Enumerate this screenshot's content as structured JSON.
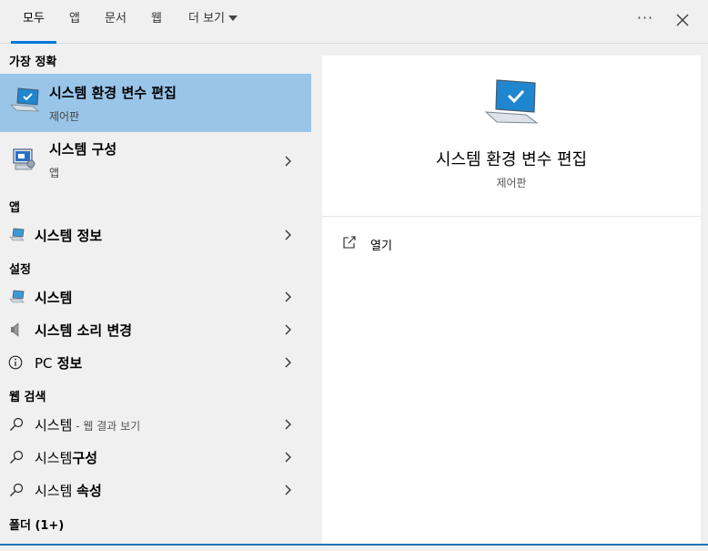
{
  "tabs": [
    {
      "label": "모두",
      "active": true
    },
    {
      "label": "앱",
      "active": false
    },
    {
      "label": "문서",
      "active": false
    },
    {
      "label": "웹",
      "active": false
    },
    {
      "label": "더 보기",
      "active": false
    }
  ],
  "header": {
    "more_options": "···"
  },
  "best_match": {
    "section_label": "가장 정확",
    "title": "시스템 환경 변수 편집",
    "subtitle": "제어판"
  },
  "sys_config": {
    "title": "시스템 구성",
    "subtitle": "앱"
  },
  "apps_section": {
    "label": "앱",
    "items": [
      {
        "title": "시스템 정보"
      }
    ]
  },
  "settings_section": {
    "label": "설정",
    "items": [
      {
        "title": "시스템"
      },
      {
        "title": "시스템 소리 변경"
      },
      {
        "title_prefix": "PC",
        "title_bold": " 정보"
      }
    ]
  },
  "web_section": {
    "label": "웹 검색",
    "items": [
      {
        "title": "시스템",
        "suffix": " - 웹 결과 보기"
      },
      {
        "title": "시스템",
        "bold": "구성"
      },
      {
        "title": "시스템 ",
        "bold": "속성"
      }
    ]
  },
  "folders_section": {
    "label": "폴더 (1+)"
  },
  "detail": {
    "title": "시스템 환경 변수 편집",
    "subtitle": "제어판",
    "open_label": "열기"
  },
  "colors": {
    "accent": "#0078d7",
    "selected": "#99c5e9"
  }
}
